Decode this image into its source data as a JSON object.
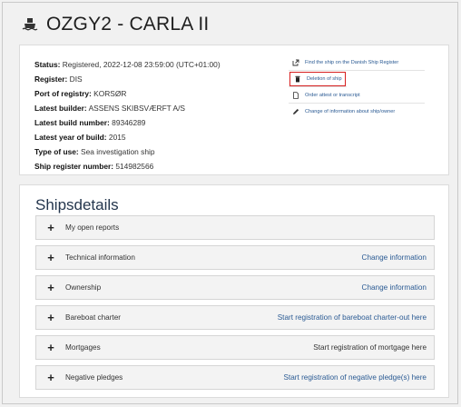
{
  "header": {
    "title": "OZGY2 - CARLA II"
  },
  "info": [
    {
      "label": "Status:",
      "value": "Registered, 2022-12-08 23:59:00 (UTC+01:00)"
    },
    {
      "label": "Register:",
      "value": "DIS"
    },
    {
      "label": "Port of registry:",
      "value": "KORSØR"
    },
    {
      "label": "Latest builder:",
      "value": "ASSENS SKIBSVÆRFT A/S"
    },
    {
      "label": "Latest build number:",
      "value": "89346289"
    },
    {
      "label": "Latest year of build:",
      "value": "2015"
    },
    {
      "label": "Type of use:",
      "value": "Sea investigation ship"
    },
    {
      "label": "Ship register number:",
      "value": "514982566"
    }
  ],
  "actions": [
    {
      "label": "Find the ship on the Danish Ship Register",
      "icon": "external-link-icon"
    },
    {
      "label": "Deletion of ship",
      "icon": "trash-icon"
    },
    {
      "label": "Order attest or transcript",
      "icon": "document-icon"
    },
    {
      "label": "Change of information about ship/owner",
      "icon": "pencil-icon"
    }
  ],
  "details": {
    "title": "Shipsdetails",
    "sections": [
      {
        "label": "My open reports",
        "link": ""
      },
      {
        "label": "Technical information",
        "link": "Change information"
      },
      {
        "label": "Ownership",
        "link": "Change information"
      },
      {
        "label": "Bareboat charter",
        "link": "Start registration of bareboat charter-out here"
      },
      {
        "label": "Mortgages",
        "link": "Start registration of mortgage here"
      },
      {
        "label": "Negative pledges",
        "link": "Start registration of negative pledge(s) here"
      }
    ]
  },
  "colors": {
    "link": "#2a5a93",
    "highlight": "#d71f1f",
    "title": "#24364d"
  }
}
